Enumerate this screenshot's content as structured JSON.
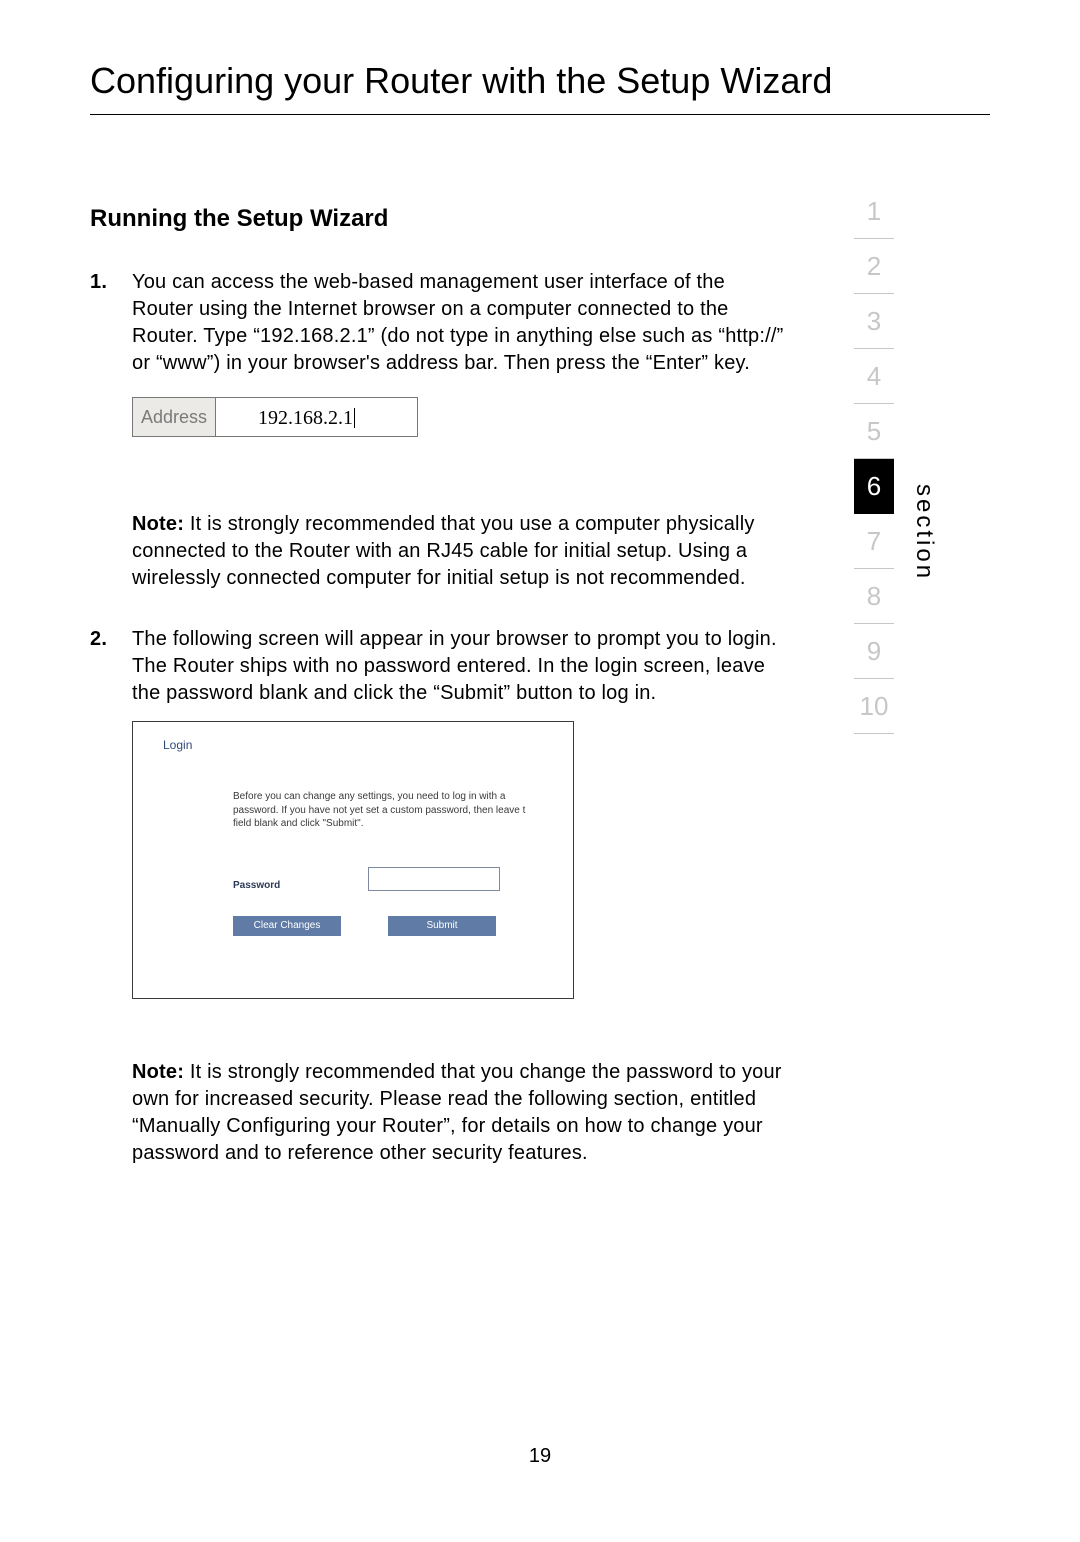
{
  "title": "Configuring your Router with the Setup Wizard",
  "subhead": "Running the Setup Wizard",
  "steps": {
    "s1_num": "1.",
    "s1_text": "You can access the web-based management user interface of the Router using the Internet browser on a computer connected to the Router. Type “192.168.2.1” (do not type in anything else such as “http://” or “www”) in your browser's address bar. Then press the “Enter” key.",
    "s2_num": "2.",
    "s2_text": "The following screen will appear in your browser to prompt you to login. The Router ships with no password entered. In the login screen, leave the password blank and click the “Submit” button to log in."
  },
  "address_bar": {
    "label": "Address",
    "value": "192.168.2.1"
  },
  "note1_bold": "Note:",
  "note1_text": " It is strongly recommended that you use a computer physically connected to the Router with an RJ45 cable for initial setup. Using a wirelessly connected computer for initial setup is not recommended.",
  "note2_bold": "Note:",
  "note2_text": " It is strongly recommended that you change the password to your own for increased security. Please read the following section, entitled “Manually Configuring your Router”, for details on how to change your password and to reference other security features.",
  "login": {
    "heading": "Login",
    "desc_l1": "Before you can change any settings, you need to log in with a",
    "desc_l2": "password. If you have not yet set a custom password, then leave t",
    "desc_l3": "field blank and click \"Submit\".",
    "pw_label": "Password",
    "clear": "Clear Changes",
    "submit": "Submit"
  },
  "section_nav": [
    "1",
    "2",
    "3",
    "4",
    "5",
    "6",
    "7",
    "8",
    "9",
    "10"
  ],
  "section_active_index": 5,
  "section_word": "section",
  "page_number": "19"
}
